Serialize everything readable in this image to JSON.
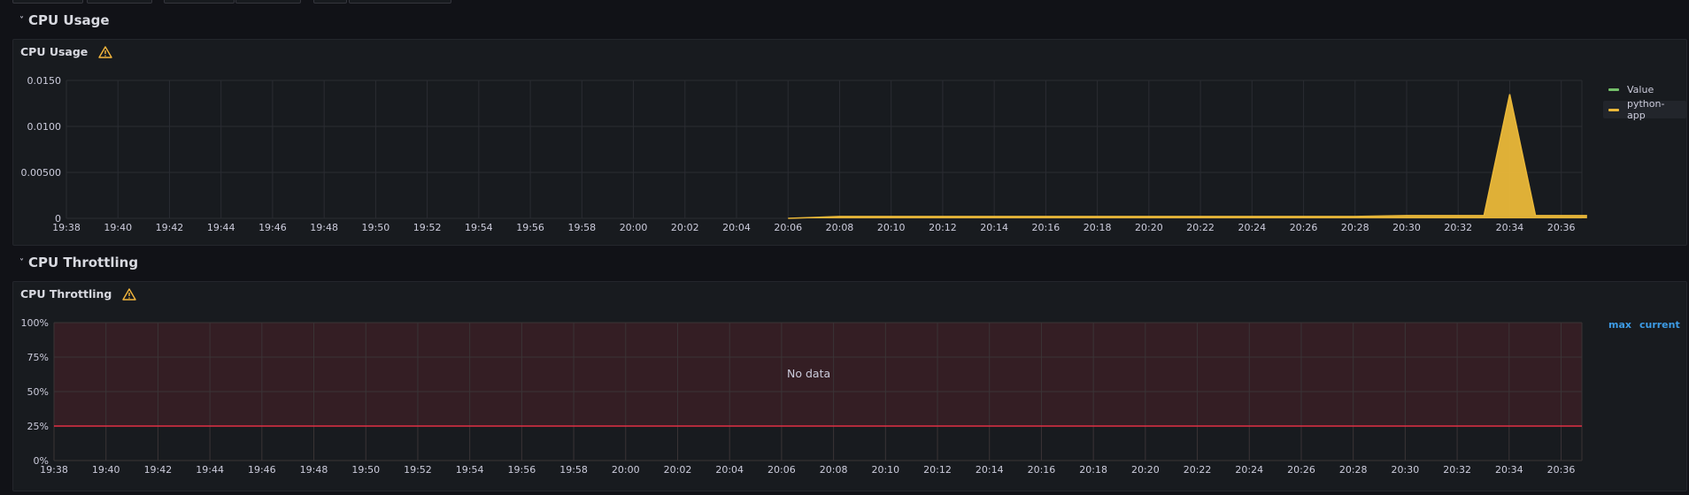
{
  "rows": [
    {
      "title": "CPU Usage"
    },
    {
      "title": "CPU Throttling"
    }
  ],
  "colors": {
    "series_python_app": "#eab839",
    "series_value": "#73bf69",
    "threshold": "#e02f44",
    "link": "#3d9ce6",
    "grid": "#2a2c32"
  },
  "icons": [
    "chevron-down-icon",
    "warning-icon"
  ],
  "panels": [
    {
      "title": "CPU Usage",
      "legend": [
        "Value",
        "python-app"
      ],
      "chart_data": {
        "type": "area",
        "x": [
          "20:06",
          "20:07",
          "20:08",
          "20:10",
          "20:12",
          "20:14",
          "20:16",
          "20:18",
          "20:20",
          "20:22",
          "20:24",
          "20:26",
          "20:28",
          "20:30",
          "20:32",
          "20:33",
          "20:34",
          "20:35",
          "20:36",
          "20:37"
        ],
        "series": [
          {
            "name": "python-app",
            "values": [
              0,
              0.0001,
              0.0002,
              0.0002,
              0.0002,
              0.0002,
              0.0002,
              0.0002,
              0.0002,
              0.0002,
              0.0002,
              0.0002,
              0.0002,
              0.0003,
              0.0003,
              0.0003,
              0.0135,
              0.0003,
              0.0003,
              0.0003
            ]
          },
          {
            "name": "Value",
            "values": []
          }
        ],
        "y_ticks": [
          "0",
          "0.00500",
          "0.0100",
          "0.0150"
        ],
        "ylim": [
          0,
          0.015
        ],
        "x_ticks": [
          "19:38",
          "19:40",
          "19:42",
          "19:44",
          "19:46",
          "19:48",
          "19:50",
          "19:52",
          "19:54",
          "19:56",
          "19:58",
          "20:00",
          "20:02",
          "20:04",
          "20:06",
          "20:08",
          "20:10",
          "20:12",
          "20:14",
          "20:16",
          "20:18",
          "20:20",
          "20:22",
          "20:24",
          "20:26",
          "20:28",
          "20:30",
          "20:32",
          "20:34",
          "20:36"
        ],
        "grid": true,
        "legend_position": "right"
      }
    },
    {
      "title": "CPU Throttling",
      "legend": [
        "max",
        "current"
      ],
      "no_data": "No data",
      "chart_data": {
        "type": "line",
        "series": [],
        "y_ticks": [
          "0%",
          "25%",
          "50%",
          "75%",
          "100%"
        ],
        "ylim": [
          0,
          100
        ],
        "threshold": 25,
        "x_ticks": [
          "19:38",
          "19:40",
          "19:42",
          "19:44",
          "19:46",
          "19:48",
          "19:50",
          "19:52",
          "19:54",
          "19:56",
          "19:58",
          "20:00",
          "20:02",
          "20:04",
          "20:06",
          "20:08",
          "20:10",
          "20:12",
          "20:14",
          "20:16",
          "20:18",
          "20:20",
          "20:22",
          "20:24",
          "20:26",
          "20:28",
          "20:30",
          "20:32",
          "20:34",
          "20:36"
        ],
        "grid": true,
        "legend_position": "top-right"
      }
    }
  ]
}
